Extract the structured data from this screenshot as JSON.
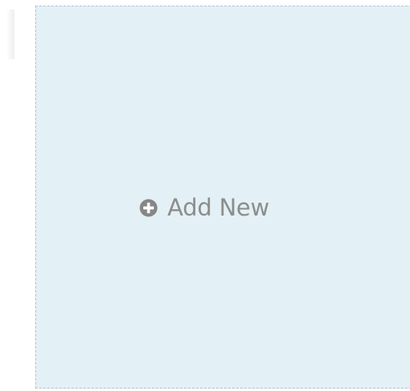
{
  "tile": {
    "label": "Add New",
    "icon": "plus-circle-icon",
    "colors": {
      "background": "#e3f0f5",
      "border": "#b9c3c8",
      "text": "#8c8c8c"
    }
  }
}
